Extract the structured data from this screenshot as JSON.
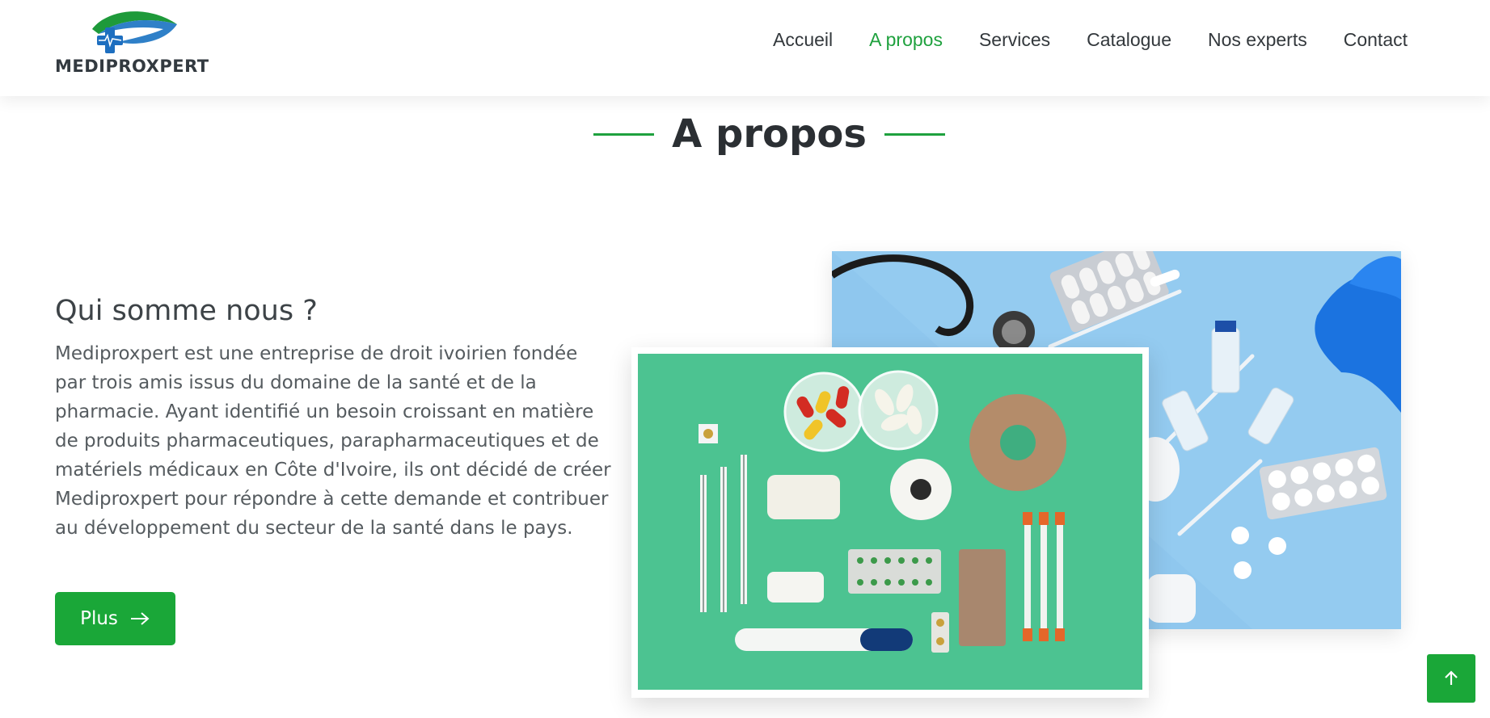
{
  "brand": {
    "name": "MEDIPROXPERT",
    "accent_color": "#1fa13e"
  },
  "nav": {
    "items": [
      {
        "label": "Accueil",
        "active": false
      },
      {
        "label": "A propos",
        "active": true
      },
      {
        "label": "Services",
        "active": false
      },
      {
        "label": "Catalogue",
        "active": false
      },
      {
        "label": "Nos experts",
        "active": false
      },
      {
        "label": "Contact",
        "active": false
      }
    ]
  },
  "about": {
    "section_title": "A propos",
    "heading": "Qui somme nous ?",
    "body": "Mediproxpert est une entreprise de droit ivoirien fondée par trois amis issus du domaine de la santé et de la pharmacie. Ayant identifié un besoin croissant en matière de produits pharmaceutiques, parapharmaceutiques et de matériels médicaux en Côte d'Ivoire, ils ont décidé de créer Mediproxpert pour répondre à cette demande et contribuer au développement du secteur de la santé dans le pays.",
    "button_label": "Plus",
    "button_icon": "arrow-right-icon"
  },
  "images": {
    "back_background": "#8fc7ee",
    "front_background": "#4cc391"
  },
  "scroll_top": {
    "icon": "arrow-up-icon",
    "color": "#1aa738"
  }
}
